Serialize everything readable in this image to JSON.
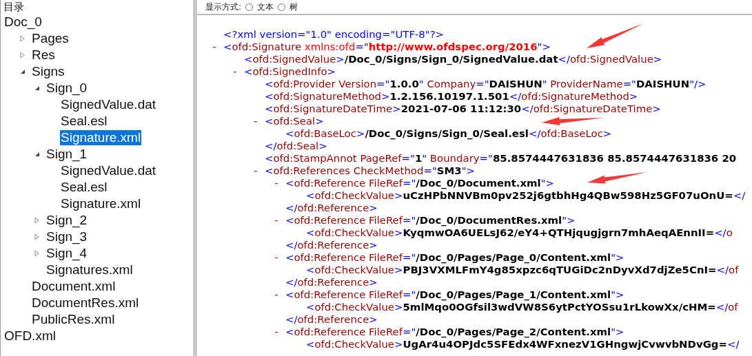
{
  "tree": {
    "title": "目录",
    "items": [
      {
        "label": "Doc_0",
        "selected": false,
        "children": [
          {
            "label": "Pages",
            "expanded": false,
            "selected": false
          },
          {
            "label": "Res",
            "expanded": false,
            "selected": false
          },
          {
            "label": "Signs",
            "expanded": true,
            "selected": false,
            "children": [
              {
                "label": "Sign_0",
                "expanded": true,
                "selected": false,
                "children": [
                  {
                    "label": "SignedValue.dat",
                    "selected": false
                  },
                  {
                    "label": "Seal.esl",
                    "selected": false
                  },
                  {
                    "label": "Signature.xml",
                    "selected": true
                  }
                ]
              },
              {
                "label": "Sign_1",
                "expanded": true,
                "selected": false,
                "children": [
                  {
                    "label": "SignedValue.dat",
                    "selected": false
                  },
                  {
                    "label": "Seal.esl",
                    "selected": false
                  },
                  {
                    "label": "Signature.xml",
                    "selected": false
                  }
                ]
              },
              {
                "label": "Sign_2",
                "expanded": false,
                "selected": false
              },
              {
                "label": "Sign_3",
                "expanded": false,
                "selected": false
              },
              {
                "label": "Sign_4",
                "expanded": false,
                "selected": false
              },
              {
                "label": "Signatures.xml",
                "selected": false
              }
            ]
          },
          {
            "label": "Document.xml",
            "selected": false
          },
          {
            "label": "DocumentRes.xml",
            "selected": false
          },
          {
            "label": "PublicRes.xml",
            "selected": false
          }
        ]
      },
      {
        "label": "OFD.xml",
        "selected": false
      }
    ]
  },
  "view_mode": {
    "label": "显示方式:",
    "options": [
      {
        "label": "文本",
        "selected": false
      },
      {
        "label": "树",
        "selected": false
      }
    ]
  },
  "xml": [
    {
      "parts": [
        {
          "kind": "punct",
          "text": "<?xml version=\"1.0\" encoding=\"UTF-8\"?>"
        }
      ]
    },
    {
      "toggle": "-",
      "parts": [
        {
          "kind": "punct",
          "text": "<"
        },
        {
          "kind": "name",
          "text": "ofd:Signature"
        },
        {
          "kind": "ns",
          "text": " xmlns:ofd"
        },
        {
          "kind": "punct",
          "text": "=\""
        },
        {
          "kind": "nsvalue",
          "text": "http://www.ofdspec.org/2016"
        },
        {
          "kind": "punct",
          "text": "\">"
        }
      ],
      "children": [
        {
          "parts": [
            {
              "kind": "punct",
              "text": "<"
            },
            {
              "kind": "name",
              "text": "ofd:SignedValue"
            },
            {
              "kind": "punct",
              "text": ">"
            },
            {
              "kind": "value",
              "text": "/Doc_0/Signs/Sign_0/SignedValue.dat"
            },
            {
              "kind": "punct",
              "text": "</"
            },
            {
              "kind": "name",
              "text": "ofd:SignedValue"
            },
            {
              "kind": "punct",
              "text": ">"
            }
          ]
        },
        {
          "toggle": "-",
          "parts": [
            {
              "kind": "punct",
              "text": "<"
            },
            {
              "kind": "name",
              "text": "ofd:SignedInfo"
            },
            {
              "kind": "punct",
              "text": ">"
            }
          ],
          "children": [
            {
              "parts": [
                {
                  "kind": "punct",
                  "text": "<"
                },
                {
                  "kind": "name",
                  "text": "ofd:Provider Version"
                },
                {
                  "kind": "punct",
                  "text": "=\""
                },
                {
                  "kind": "value",
                  "text": "1.0.0"
                },
                {
                  "kind": "punct",
                  "text": "\""
                },
                {
                  "kind": "name",
                  "text": " Company"
                },
                {
                  "kind": "punct",
                  "text": "=\""
                },
                {
                  "kind": "value",
                  "text": "DAISHUN"
                },
                {
                  "kind": "punct",
                  "text": "\""
                },
                {
                  "kind": "name",
                  "text": " ProviderName"
                },
                {
                  "kind": "punct",
                  "text": "=\""
                },
                {
                  "kind": "value",
                  "text": "DAISHUN"
                },
                {
                  "kind": "punct",
                  "text": "\"/>"
                }
              ]
            },
            {
              "parts": [
                {
                  "kind": "punct",
                  "text": "<"
                },
                {
                  "kind": "name",
                  "text": "ofd:SignatureMethod"
                },
                {
                  "kind": "punct",
                  "text": ">"
                },
                {
                  "kind": "value",
                  "text": "1.2.156.10197.1.501"
                },
                {
                  "kind": "punct",
                  "text": "</"
                },
                {
                  "kind": "name",
                  "text": "ofd:SignatureMethod"
                },
                {
                  "kind": "punct",
                  "text": ">"
                }
              ]
            },
            {
              "parts": [
                {
                  "kind": "punct",
                  "text": "<"
                },
                {
                  "kind": "name",
                  "text": "ofd:SignatureDateTime"
                },
                {
                  "kind": "punct",
                  "text": ">"
                },
                {
                  "kind": "value",
                  "text": "2021-07-06 11:12:30"
                },
                {
                  "kind": "punct",
                  "text": "</"
                },
                {
                  "kind": "name",
                  "text": "ofd:SignatureDateTime"
                },
                {
                  "kind": "punct",
                  "text": ">"
                }
              ]
            },
            {
              "toggle": "-",
              "parts": [
                {
                  "kind": "punct",
                  "text": "<"
                },
                {
                  "kind": "name",
                  "text": "ofd:Seal"
                },
                {
                  "kind": "punct",
                  "text": ">"
                }
              ],
              "children": [
                {
                  "parts": [
                    {
                      "kind": "punct",
                      "text": "<"
                    },
                    {
                      "kind": "name",
                      "text": "ofd:BaseLoc"
                    },
                    {
                      "kind": "punct",
                      "text": ">"
                    },
                    {
                      "kind": "value",
                      "text": "/Doc_0/Signs/Sign_0/Seal.esl"
                    },
                    {
                      "kind": "punct",
                      "text": "</"
                    },
                    {
                      "kind": "name",
                      "text": "ofd:BaseLoc"
                    },
                    {
                      "kind": "punct",
                      "text": ">"
                    }
                  ]
                }
              ],
              "close": [
                {
                  "kind": "punct",
                  "text": "</"
                },
                {
                  "kind": "name",
                  "text": "ofd:Seal"
                },
                {
                  "kind": "punct",
                  "text": ">"
                }
              ]
            },
            {
              "parts": [
                {
                  "kind": "punct",
                  "text": "<"
                },
                {
                  "kind": "name",
                  "text": "ofd:StampAnnot PageRef"
                },
                {
                  "kind": "punct",
                  "text": "=\""
                },
                {
                  "kind": "value",
                  "text": "1"
                },
                {
                  "kind": "punct",
                  "text": "\""
                },
                {
                  "kind": "name",
                  "text": " Boundary"
                },
                {
                  "kind": "punct",
                  "text": "=\""
                },
                {
                  "kind": "value",
                  "text": "85.8574447631836 85.8574447631836 20"
                }
              ]
            },
            {
              "toggle": "-",
              "parts": [
                {
                  "kind": "punct",
                  "text": "<"
                },
                {
                  "kind": "name",
                  "text": "ofd:References CheckMethod"
                },
                {
                  "kind": "punct",
                  "text": "=\""
                },
                {
                  "kind": "value",
                  "text": "SM3"
                },
                {
                  "kind": "punct",
                  "text": "\">"
                }
              ],
              "children": [
                {
                  "toggle": "-",
                  "parts": [
                    {
                      "kind": "punct",
                      "text": "<"
                    },
                    {
                      "kind": "name",
                      "text": "ofd:Reference FileRef"
                    },
                    {
                      "kind": "punct",
                      "text": "=\""
                    },
                    {
                      "kind": "value",
                      "text": "/Doc_0/Document.xml"
                    },
                    {
                      "kind": "punct",
                      "text": "\">"
                    }
                  ],
                  "children": [
                    {
                      "parts": [
                        {
                          "kind": "punct",
                          "text": "<"
                        },
                        {
                          "kind": "name",
                          "text": "ofd:CheckValue"
                        },
                        {
                          "kind": "punct",
                          "text": ">"
                        },
                        {
                          "kind": "value",
                          "text": "uCzHPbNNVBm0pv252j6gtbhHg4QBw598Hz5GF07uOnU="
                        },
                        {
                          "kind": "punct",
                          "text": "</"
                        }
                      ]
                    }
                  ],
                  "close": [
                    {
                      "kind": "punct",
                      "text": "</"
                    },
                    {
                      "kind": "name",
                      "text": "ofd:Reference"
                    },
                    {
                      "kind": "punct",
                      "text": ">"
                    }
                  ]
                },
                {
                  "toggle": "-",
                  "parts": [
                    {
                      "kind": "punct",
                      "text": "<"
                    },
                    {
                      "kind": "name",
                      "text": "ofd:Reference FileRef"
                    },
                    {
                      "kind": "punct",
                      "text": "=\""
                    },
                    {
                      "kind": "value",
                      "text": "/Doc_0/DocumentRes.xml"
                    },
                    {
                      "kind": "punct",
                      "text": "\">"
                    }
                  ],
                  "children": [
                    {
                      "parts": [
                        {
                          "kind": "punct",
                          "text": "<"
                        },
                        {
                          "kind": "name",
                          "text": "ofd:CheckValue"
                        },
                        {
                          "kind": "punct",
                          "text": ">"
                        },
                        {
                          "kind": "value",
                          "text": "KyqmwOA6UELsJ62/eY4+QTHjqugjgrn7mhAeqAEnnII="
                        },
                        {
                          "kind": "punct",
                          "text": "</"
                        },
                        {
                          "kind": "name",
                          "text": "o"
                        }
                      ]
                    }
                  ],
                  "close": [
                    {
                      "kind": "punct",
                      "text": "</"
                    },
                    {
                      "kind": "name",
                      "text": "ofd:Reference"
                    },
                    {
                      "kind": "punct",
                      "text": ">"
                    }
                  ]
                },
                {
                  "toggle": "-",
                  "parts": [
                    {
                      "kind": "punct",
                      "text": "<"
                    },
                    {
                      "kind": "name",
                      "text": "ofd:Reference FileRef"
                    },
                    {
                      "kind": "punct",
                      "text": "=\""
                    },
                    {
                      "kind": "value",
                      "text": "/Doc_0/Pages/Page_0/Content.xml"
                    },
                    {
                      "kind": "punct",
                      "text": "\">"
                    }
                  ],
                  "children": [
                    {
                      "parts": [
                        {
                          "kind": "punct",
                          "text": "<"
                        },
                        {
                          "kind": "name",
                          "text": "ofd:CheckValue"
                        },
                        {
                          "kind": "punct",
                          "text": ">"
                        },
                        {
                          "kind": "value",
                          "text": "PBJ3VXMLFmY4g85xpzc6qTUGiDc2nDyvXd7djZe5CnI="
                        },
                        {
                          "kind": "punct",
                          "text": "</"
                        },
                        {
                          "kind": "name",
                          "text": "of"
                        }
                      ]
                    }
                  ],
                  "close": [
                    {
                      "kind": "punct",
                      "text": "</"
                    },
                    {
                      "kind": "name",
                      "text": "ofd:Reference"
                    },
                    {
                      "kind": "punct",
                      "text": ">"
                    }
                  ]
                },
                {
                  "toggle": "-",
                  "parts": [
                    {
                      "kind": "punct",
                      "text": "<"
                    },
                    {
                      "kind": "name",
                      "text": "ofd:Reference FileRef"
                    },
                    {
                      "kind": "punct",
                      "text": "=\""
                    },
                    {
                      "kind": "value",
                      "text": "/Doc_0/Pages/Page_1/Content.xml"
                    },
                    {
                      "kind": "punct",
                      "text": "\">"
                    }
                  ],
                  "children": [
                    {
                      "parts": [
                        {
                          "kind": "punct",
                          "text": "<"
                        },
                        {
                          "kind": "name",
                          "text": "ofd:CheckValue"
                        },
                        {
                          "kind": "punct",
                          "text": ">"
                        },
                        {
                          "kind": "value",
                          "text": "5mlMqo0OGfsil3wdVW8S6ytPctYOSsu1rLkowXx/cHM="
                        },
                        {
                          "kind": "punct",
                          "text": "</"
                        },
                        {
                          "kind": "name",
                          "text": "of"
                        }
                      ]
                    }
                  ],
                  "close": [
                    {
                      "kind": "punct",
                      "text": "</"
                    },
                    {
                      "kind": "name",
                      "text": "ofd:Reference"
                    },
                    {
                      "kind": "punct",
                      "text": ">"
                    }
                  ]
                },
                {
                  "toggle": "-",
                  "parts": [
                    {
                      "kind": "punct",
                      "text": "<"
                    },
                    {
                      "kind": "name",
                      "text": "ofd:Reference FileRef"
                    },
                    {
                      "kind": "punct",
                      "text": "=\""
                    },
                    {
                      "kind": "value",
                      "text": "/Doc_0/Pages/Page_2/Content.xml"
                    },
                    {
                      "kind": "punct",
                      "text": "\">"
                    }
                  ],
                  "children": [
                    {
                      "parts": [
                        {
                          "kind": "punct",
                          "text": "<"
                        },
                        {
                          "kind": "name",
                          "text": "ofd:CheckValue"
                        },
                        {
                          "kind": "punct",
                          "text": ">"
                        },
                        {
                          "kind": "value",
                          "text": "UgAr4u4OPJdc5SFEdx4WFxnezV1GHngwjCvwvbNDvGg="
                        },
                        {
                          "kind": "punct",
                          "text": "</"
                        }
                      ]
                    }
                  ]
                }
              ]
            }
          ]
        }
      ]
    }
  ]
}
